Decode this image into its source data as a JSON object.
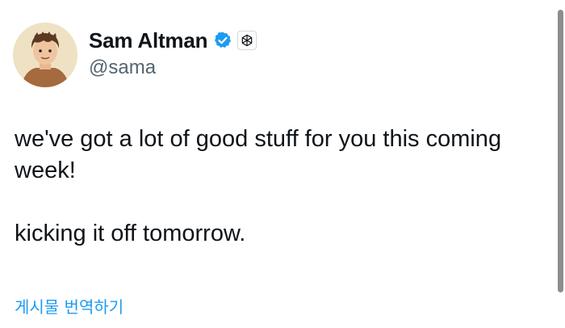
{
  "author": {
    "display_name": "Sam Altman",
    "handle": "@sama",
    "avatar_icon": "avatar-illustration",
    "verified_icon": "verified-badge-icon",
    "affiliate_icon": "openai-logo-icon"
  },
  "tweet": {
    "lines": [
      "we've got a lot of good stuff for you this coming week!",
      "kicking it off tomorrow."
    ],
    "translate_link": "게시물 번역하기"
  },
  "colors": {
    "accent": "#1d9bf0",
    "text": "#0f1419",
    "secondary_text": "#536471"
  }
}
